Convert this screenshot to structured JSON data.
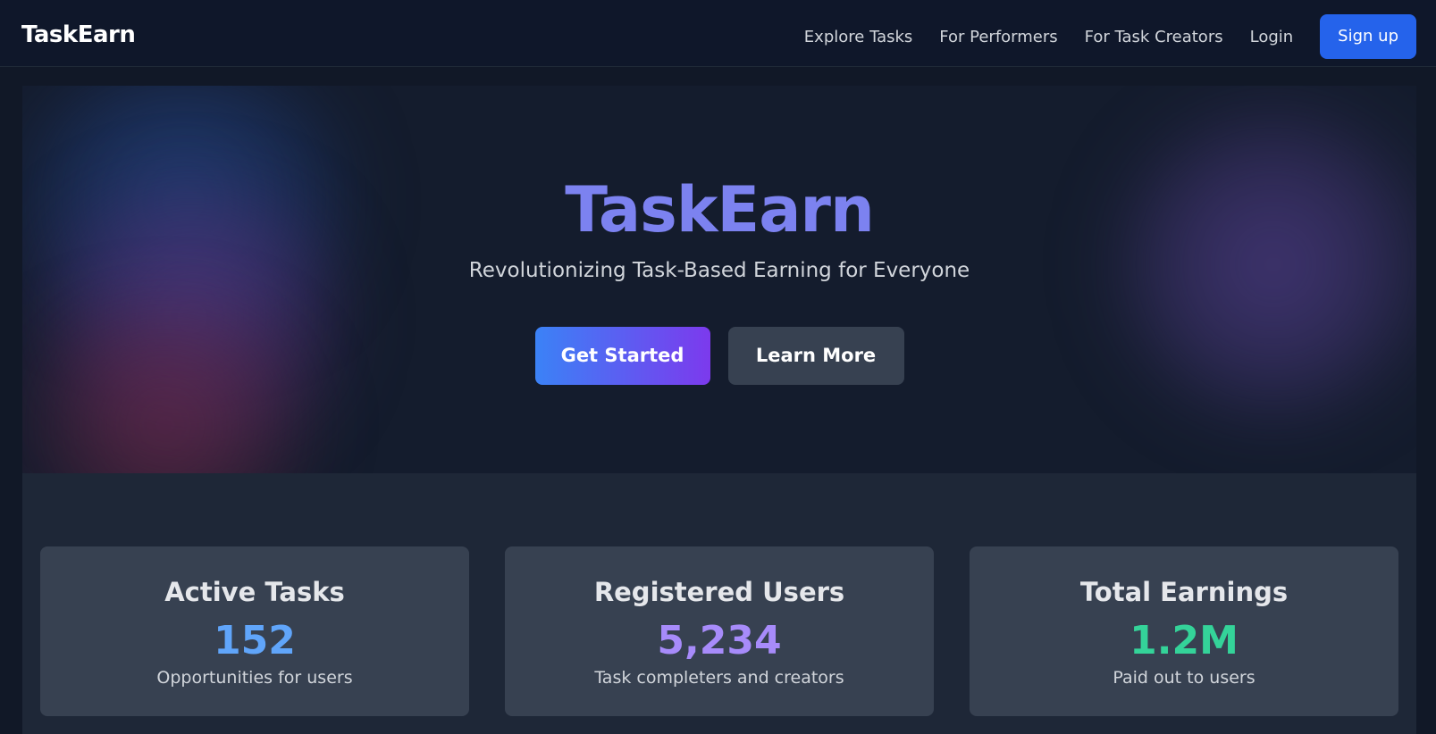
{
  "nav": {
    "brand": "TaskEarn",
    "links": [
      "Explore Tasks",
      "For Performers",
      "For Task Creators"
    ],
    "login": "Login",
    "signup": "Sign up"
  },
  "hero": {
    "title": "TaskEarn",
    "subtitle": "Revolutionizing Task-Based Earning for Everyone",
    "primary_button": "Get Started",
    "secondary_button": "Learn More"
  },
  "stats": [
    {
      "title": "Active Tasks",
      "value": "152",
      "description": "Opportunities for users",
      "color": "#60a5fa"
    },
    {
      "title": "Registered Users",
      "value": "5,234",
      "description": "Task completers and creators",
      "color": "#a78bfa"
    },
    {
      "title": "Total Earnings",
      "value": "1.2M",
      "description": "Paid out to users",
      "color": "#34d399"
    }
  ],
  "colors": {
    "accent": "#2563eb",
    "hero_title": "#7c82f0",
    "background": "#111827"
  }
}
